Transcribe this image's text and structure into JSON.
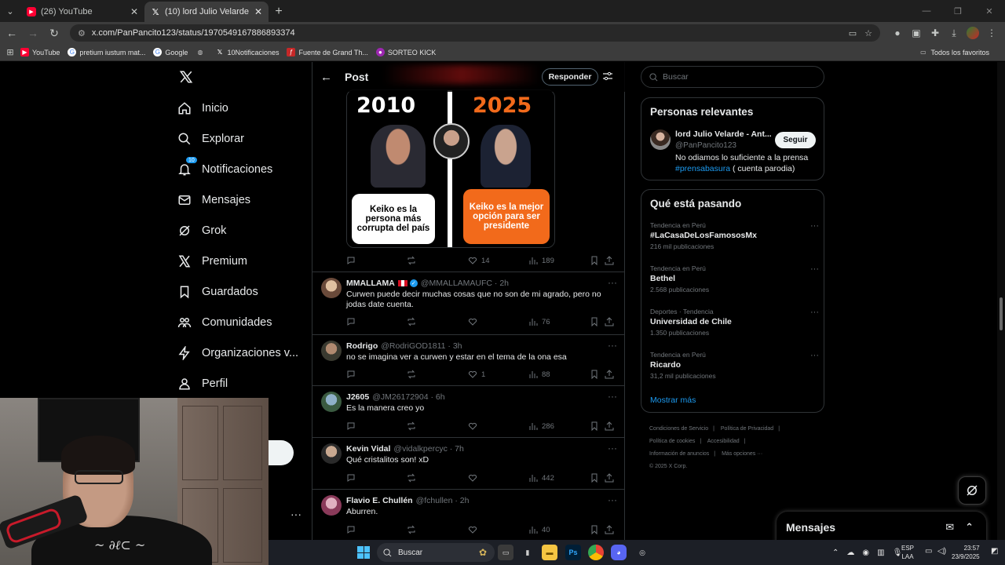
{
  "browser": {
    "tabs": [
      {
        "title": "(26) YouTube",
        "icon": "youtube-icon",
        "active": false
      },
      {
        "title": "(10) lord Julio Velarde - Antizurda",
        "icon": "x-icon",
        "active": true
      }
    ],
    "url": "x.com/PanPancito123/status/1970549167886893374",
    "bookmarks": [
      "YouTube",
      "pretium iustum mat...",
      "Google",
      "",
      "10Notificaciones",
      "Fuente de Grand Th...",
      "SORTEO KICK"
    ],
    "all_bookmarks": "Todos los favoritos"
  },
  "nav": {
    "items": [
      {
        "label": "Inicio",
        "icon": "home-icon"
      },
      {
        "label": "Explorar",
        "icon": "search-icon"
      },
      {
        "label": "Notificaciones",
        "icon": "bell-icon"
      },
      {
        "label": "Mensajes",
        "icon": "mail-icon"
      },
      {
        "label": "Grok",
        "icon": "grok-icon"
      },
      {
        "label": "Premium",
        "icon": "x-premium-icon"
      },
      {
        "label": "Guardados",
        "icon": "bookmark-icon"
      },
      {
        "label": "Comunidades",
        "icon": "communities-icon"
      },
      {
        "label": "Organizaciones v...",
        "icon": "lightning-icon"
      },
      {
        "label": "Perfil",
        "icon": "person-icon"
      }
    ],
    "notif_badge": "10"
  },
  "post": {
    "header_title": "Post",
    "reply_button": "Responder",
    "image": {
      "year_left": "2010",
      "year_right": "2025",
      "bubble_left": "Keiko es la persona más corrupta del país",
      "bubble_right": "Keiko es la mejor opción para ser presidente"
    },
    "stats": {
      "likes": "14",
      "views": "189"
    }
  },
  "replies": [
    {
      "name": "MMALLAMA",
      "flag": true,
      "verified": true,
      "handle": "@MMALLAMAUFC · 2h",
      "text": "Curwen puede decir muchas cosas que no son de mi agrado, pero no jodas date cuenta.",
      "likes": "",
      "views": "76"
    },
    {
      "name": "Rodrigo",
      "handle": "@RodriGOD1811 · 3h",
      "text": "no se imagina ver a curwen y estar en el tema de la ona esa",
      "likes": "1",
      "views": "88"
    },
    {
      "name": "J2605",
      "handle": "@JM26172904 · 6h",
      "text": "Es la manera creo yo",
      "likes": "",
      "views": "286"
    },
    {
      "name": "Kevin Vidal",
      "handle": "@vidalkpercyc · 7h",
      "text": "Qué cristalitos son! xD",
      "likes": "",
      "views": "442"
    },
    {
      "name": "Flavio E. Chullén",
      "handle": "@fchullen · 2h",
      "text": "Aburren.",
      "likes": "",
      "views": "40"
    }
  ],
  "sidebar": {
    "search_placeholder": "Buscar",
    "relevant_title": "Personas relevantes",
    "relevant_person": {
      "name": "lord Julio Velarde - Ant...",
      "handle": "@PanPancito123",
      "follow": "Seguir",
      "bio_pre": "No odiamos lo suficiente a la prensa",
      "bio_tag": "#prensabasura",
      "bio_post": "( cuenta parodia)"
    },
    "trending_title": "Qué está pasando",
    "trends": [
      {
        "category": "Tendencia en Perú",
        "name": "#LaCasaDeLosFamososMx",
        "count": "216 mil publicaciones"
      },
      {
        "category": "Tendencia en Perú",
        "name": "Bethel",
        "count": "2.568 publicaciones"
      },
      {
        "category": "Deportes · Tendencia",
        "name": "Universidad de Chile",
        "count": "1.350 publicaciones"
      },
      {
        "category": "Tendencia en Perú",
        "name": "Ricardo",
        "count": "31,2 mil publicaciones"
      }
    ],
    "show_more": "Mostrar más",
    "footer": [
      "Condiciones de Servicio",
      "Política de Privacidad",
      "Política de cookies",
      "Accesibilidad",
      "Información de anuncios",
      "Más opciones ···",
      "© 2025 X Corp."
    ]
  },
  "messages_drawer": "Mensajes",
  "taskbar": {
    "search": "Buscar",
    "lang": "ESP",
    "lang2": "LAA",
    "time": "23:57",
    "date": "23/9/2025"
  }
}
